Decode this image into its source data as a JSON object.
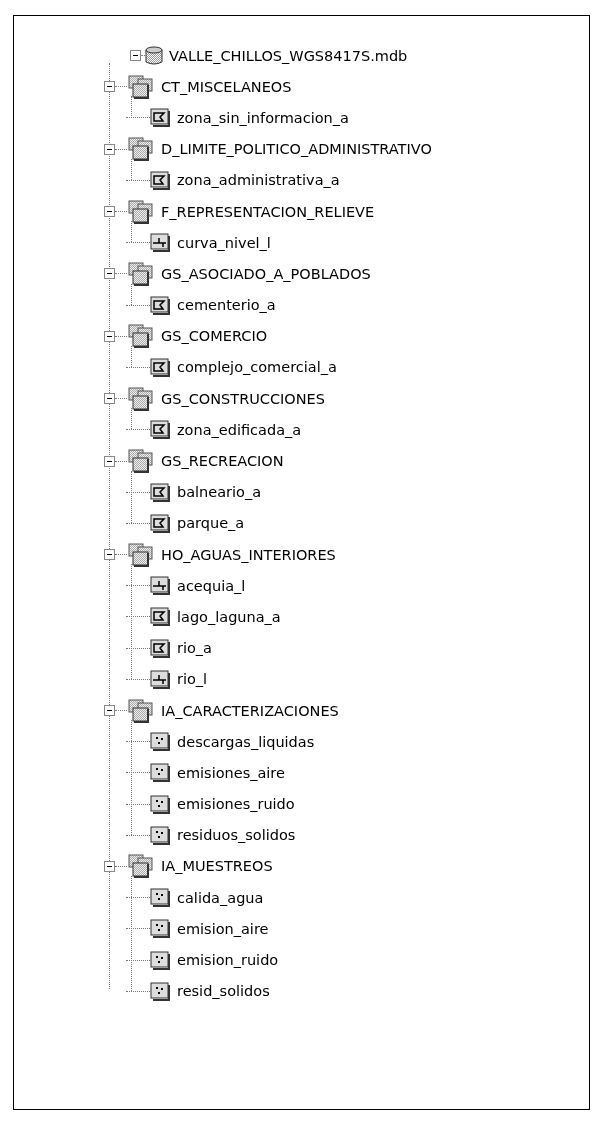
{
  "tree": [
    {
      "label": "VALLE_CHILLOS_WGS8417S.mdb",
      "kind": "database",
      "expanded": true,
      "children": [
        {
          "label": "CT_MISCELANEOS",
          "kind": "dataset",
          "expanded": true,
          "children": [
            {
              "label": "zona_sin_informacion_a",
              "kind": "polygon"
            }
          ]
        },
        {
          "label": "D_LIMITE_POLITICO_ADMINISTRATIVO",
          "kind": "dataset",
          "expanded": true,
          "children": [
            {
              "label": "zona_administrativa_a",
              "kind": "polygon"
            }
          ]
        },
        {
          "label": "F_REPRESENTACION_RELIEVE",
          "kind": "dataset",
          "expanded": true,
          "children": [
            {
              "label": "curva_nivel_l",
              "kind": "line"
            }
          ]
        },
        {
          "label": "GS_ASOCIADO_A_POBLADOS",
          "kind": "dataset",
          "expanded": true,
          "children": [
            {
              "label": "cementerio_a",
              "kind": "polygon"
            }
          ]
        },
        {
          "label": "GS_COMERCIO",
          "kind": "dataset",
          "expanded": true,
          "children": [
            {
              "label": "complejo_comercial_a",
              "kind": "polygon"
            }
          ]
        },
        {
          "label": "GS_CONSTRUCCIONES",
          "kind": "dataset",
          "expanded": true,
          "children": [
            {
              "label": "zona_edificada_a",
              "kind": "polygon"
            }
          ]
        },
        {
          "label": "GS_RECREACION",
          "kind": "dataset",
          "expanded": true,
          "children": [
            {
              "label": "balneario_a",
              "kind": "polygon"
            },
            {
              "label": "parque_a",
              "kind": "polygon"
            }
          ]
        },
        {
          "label": "HO_AGUAS_INTERIORES",
          "kind": "dataset",
          "expanded": true,
          "children": [
            {
              "label": "acequia_l",
              "kind": "line"
            },
            {
              "label": "lago_laguna_a",
              "kind": "polygon"
            },
            {
              "label": "rio_a",
              "kind": "polygon"
            },
            {
              "label": "rio_l",
              "kind": "line"
            }
          ]
        },
        {
          "label": "IA_CARACTERIZACIONES",
          "kind": "dataset",
          "expanded": true,
          "children": [
            {
              "label": "descargas_liquidas",
              "kind": "point"
            },
            {
              "label": "emisiones_aire",
              "kind": "point"
            },
            {
              "label": "emisiones_ruido",
              "kind": "point"
            },
            {
              "label": "residuos_solidos",
              "kind": "point"
            }
          ]
        },
        {
          "label": "IA_MUESTREOS",
          "kind": "dataset",
          "expanded": true,
          "children": [
            {
              "label": "calida_agua",
              "kind": "point"
            },
            {
              "label": "emision_aire",
              "kind": "point"
            },
            {
              "label": "emision_ruido",
              "kind": "point"
            },
            {
              "label": "resid_solidos",
              "kind": "point"
            }
          ]
        }
      ]
    }
  ]
}
